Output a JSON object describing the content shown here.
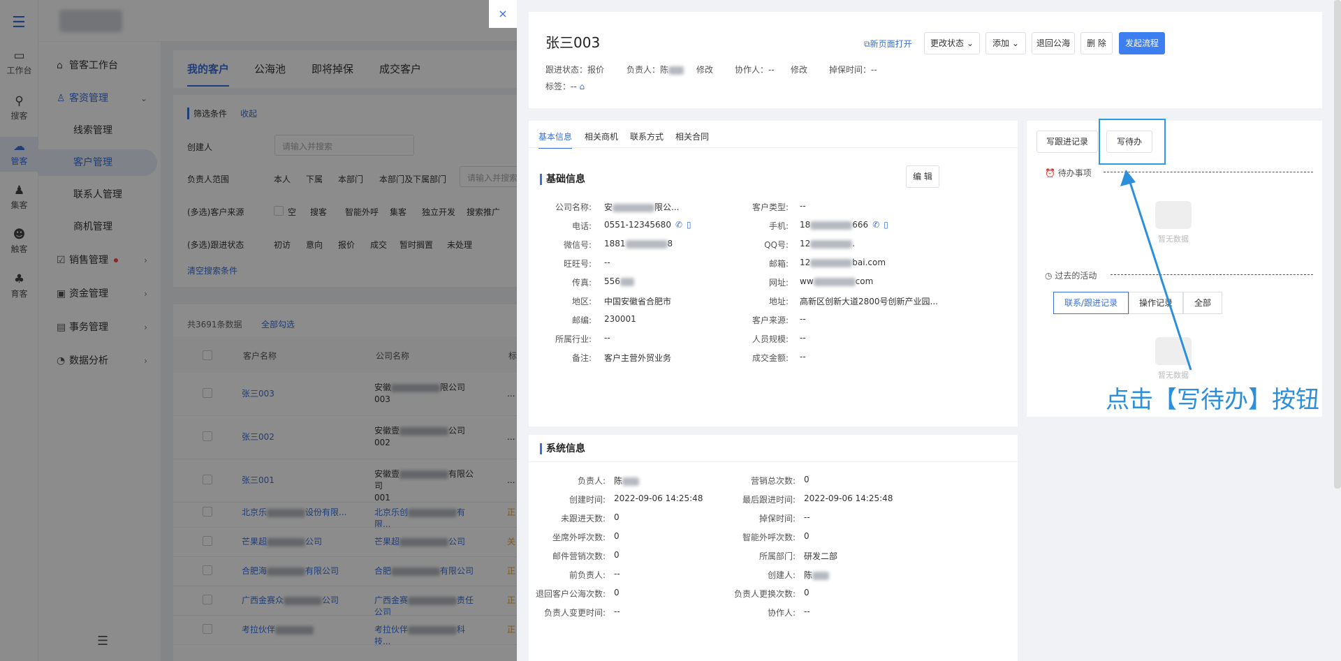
{
  "rail": {
    "items": [
      {
        "label": "工作台",
        "icon": "monitor-icon"
      },
      {
        "label": "搜客",
        "icon": "user-search-icon"
      },
      {
        "label": "管客",
        "icon": "cloud-icon"
      },
      {
        "label": "集客",
        "icon": "group-icon"
      },
      {
        "label": "触客",
        "icon": "contact-icon"
      },
      {
        "label": "育客",
        "icon": "nurture-icon"
      }
    ]
  },
  "sidenav": {
    "workbench": "管客工作台",
    "customer_mgmt": "客资管理",
    "leads": "线索管理",
    "customers": "客户管理",
    "contacts": "联系人管理",
    "opps": "商机管理",
    "sales": "销售管理",
    "funds": "资金管理",
    "affairs": "事务管理",
    "analytics": "数据分析"
  },
  "main": {
    "tabs": [
      "我的客户",
      "公海池",
      "即将掉保",
      "成交客户"
    ],
    "filter_title": "筛选条件",
    "collapse": "收起",
    "creator_label": "创建人",
    "creator_placeholder": "请输入并搜索",
    "owner_label": "负责人范围",
    "owner_opts": [
      "本人",
      "下属",
      "本部门",
      "本部门及下属部门"
    ],
    "owner_placeholder": "请输入并搜索",
    "source_label": "(多选)客户来源",
    "source_opts": [
      "空",
      "搜客",
      "智能外呼",
      "集客",
      "独立开发",
      "搜索推广"
    ],
    "status_label": "(多选)跟进状态",
    "status_opts": [
      "初访",
      "意向",
      "报价",
      "成交",
      "暂时搁置",
      "未处理"
    ],
    "clear": "清空搜索条件",
    "count": "共3691条数据",
    "select_all": "全部勾选",
    "col_name": "客户名称",
    "col_company": "公司名称",
    "col_tag": "标",
    "rows": [
      {
        "name": "张三003",
        "company1": "安徽",
        "company1b": "限公司",
        "company2": "003",
        "tag": "..."
      },
      {
        "name": "张三002",
        "company1": "安徽壹",
        "company1b": "公司",
        "company2": "002",
        "tag": "..."
      },
      {
        "name": "张三001",
        "company1": "安徽壹",
        "company1b": "有限公司",
        "company2": "001",
        "tag": "..."
      },
      {
        "name": "北京乐",
        "name2": "设份有限...",
        "company1": "北京乐创",
        "company1b": "有限...",
        "tag": "正"
      },
      {
        "name": "芒果超",
        "name2": "公司",
        "company1": "芒果超",
        "company1b": "公司",
        "tag": "关"
      },
      {
        "name": "合肥海",
        "name2": "有限公司",
        "company1": "合肥",
        "company1b": "有限公司",
        "tag": "正"
      },
      {
        "name": "广西金赛众",
        "name2": "公司",
        "company1": "广西金赛",
        "company1b": "责任公司",
        "tag": "正"
      },
      {
        "name": "考拉伙伴",
        "name2": "",
        "company1": "考拉伙伴",
        "company1b": "科技...",
        "tag": "正"
      }
    ]
  },
  "drawer": {
    "close": "×",
    "title": "张三003",
    "follow_label": "跟进状态：",
    "follow_val": "报价",
    "owner_label": "负责人：",
    "owner_val": "陈",
    "edit1": "修改",
    "collab_label": "协作人：",
    "collab_val": "--",
    "edit2": "修改",
    "drop_label": "掉保时间：",
    "drop_val": "--",
    "tags_label": "标签：",
    "tags_val": "--",
    "btn_newpage": "新页面打开",
    "btn_status": "更改状态",
    "btn_add": "添加",
    "btn_return": "退回公海",
    "btn_delete": "删 除",
    "btn_flow": "发起流程",
    "tabs": [
      "基本信息",
      "相关商机",
      "联系方式",
      "相关合同"
    ],
    "basic_title": "基础信息",
    "edit_btn": "编 辑",
    "left_fields": [
      {
        "label": "公司名称:",
        "val": "安",
        "val2": "限公..."
      },
      {
        "label": "电话:",
        "val": "0551-12345680",
        "phone": true
      },
      {
        "label": "微信号:",
        "val": "1881",
        "val2": "8"
      },
      {
        "label": "旺旺号:",
        "val": "--"
      },
      {
        "label": "传真:",
        "val": "556"
      },
      {
        "label": "地区:",
        "val": "中国安徽省合肥市"
      },
      {
        "label": "邮编:",
        "val": "230001"
      },
      {
        "label": "所属行业:",
        "val": "--"
      },
      {
        "label": "备注:",
        "val": "客户主营外贸业务"
      }
    ],
    "right_fields": [
      {
        "label": "客户类型:",
        "val": "--"
      },
      {
        "label": "手机:",
        "val": "18",
        "val2": "666",
        "phone": true
      },
      {
        "label": "QQ号:",
        "val": "12",
        "val2": "."
      },
      {
        "label": "邮箱:",
        "val": "12",
        "val2": "bai.com"
      },
      {
        "label": "网址:",
        "val": "ww",
        "val2": "com"
      },
      {
        "label": "地址:",
        "val": "高新区创新大道2800号创新产业园..."
      },
      {
        "label": "客户来源:",
        "val": "--"
      },
      {
        "label": "人员规模:",
        "val": "--"
      },
      {
        "label": "成交金额:",
        "val": "--"
      }
    ],
    "sys_title": "系统信息",
    "sys_left": [
      {
        "label": "负责人:",
        "val": "陈"
      },
      {
        "label": "创建时间:",
        "val": "2022-09-06 14:25:48"
      },
      {
        "label": "未跟进天数:",
        "val": "0"
      },
      {
        "label": "坐席外呼次数:",
        "val": "0"
      },
      {
        "label": "邮件营销次数:",
        "val": "0"
      },
      {
        "label": "前负责人:",
        "val": "--"
      },
      {
        "label": "退回客户公海次数:",
        "val": "0"
      },
      {
        "label": "负责人变更时间:",
        "val": "--"
      }
    ],
    "sys_right": [
      {
        "label": "营销总次数:",
        "val": "0"
      },
      {
        "label": "最后跟进时间:",
        "val": "2022-09-06 14:25:48"
      },
      {
        "label": "掉保时间:",
        "val": "--"
      },
      {
        "label": "智能外呼次数:",
        "val": "0"
      },
      {
        "label": "所属部门:",
        "val": "研发二部"
      },
      {
        "label": "创建人:",
        "val": "陈"
      },
      {
        "label": "负责人更换次数:",
        "val": "0"
      },
      {
        "label": "协作人:",
        "val": "--"
      }
    ],
    "btn_write_follow": "写跟进记录",
    "btn_write_todo": "写待办",
    "todo_title": "待办事项",
    "empty1": "暂无数据",
    "past_title": "过去的活动",
    "seg": [
      "联系/跟进记录",
      "操作记录",
      "全部"
    ],
    "empty2": "暂无数据"
  },
  "annotation": {
    "callout": "点击【写待办】按钮",
    "color": "#2b8fdc"
  }
}
